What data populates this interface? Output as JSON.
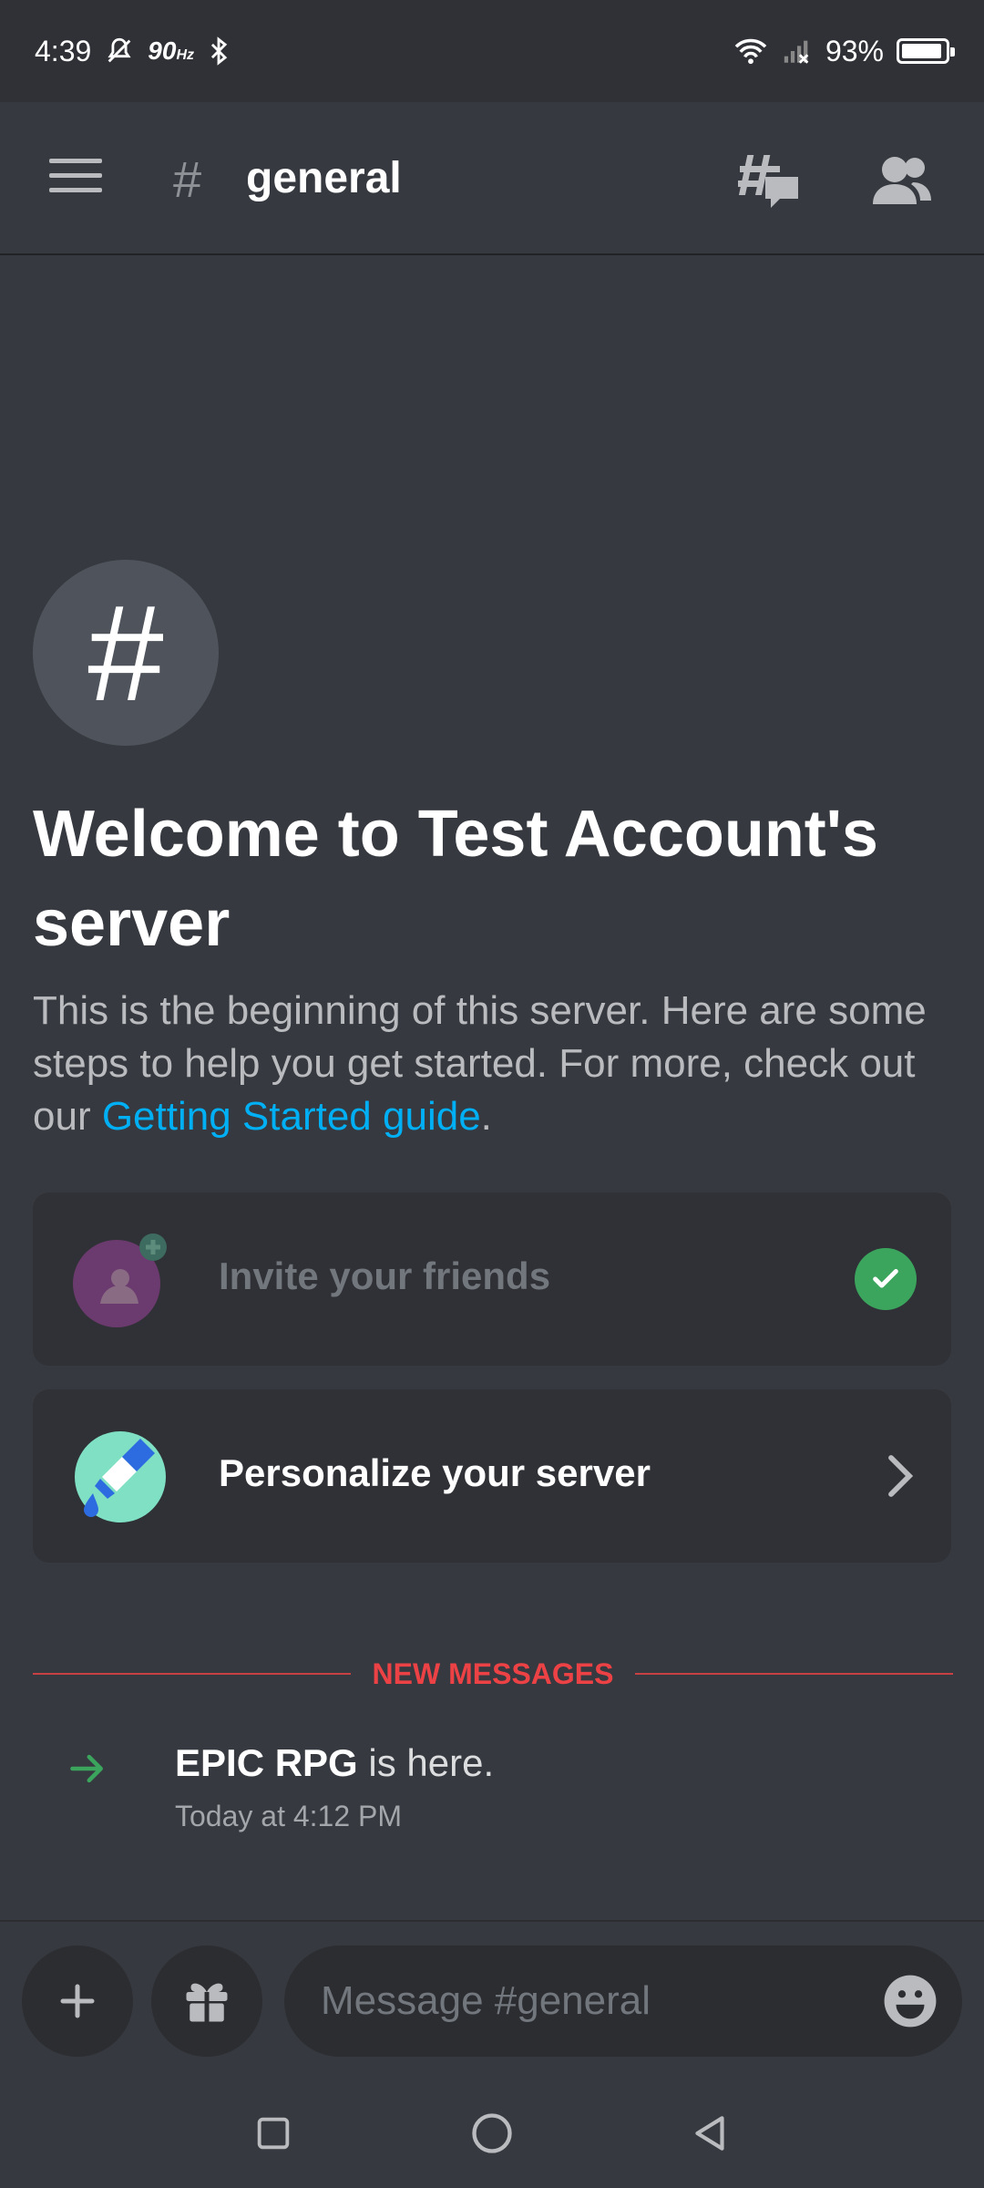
{
  "status_bar": {
    "time": "4:39",
    "refresh_rate": "90",
    "refresh_unit": "Hz",
    "battery": "93%",
    "battery_level": 0.93
  },
  "header": {
    "channel_name": "general",
    "icons": [
      "menu-icon",
      "hash-icon",
      "threads-icon",
      "members-icon"
    ]
  },
  "welcome": {
    "title": "Welcome to Test Account's server",
    "description": "This is the beginning of this server. Here are some steps to help you get started. For more, check out our ",
    "link_text": "Getting Started guide",
    "trailing": "."
  },
  "cards": [
    {
      "label": "Invite your friends",
      "completed": true
    },
    {
      "label": "Personalize your server",
      "completed": false
    }
  ],
  "divider": {
    "label": "NEW MESSAGES",
    "color": "#ed4245"
  },
  "system_message": {
    "bot_name": "EPIC RPG",
    "text": " is here.",
    "timestamp": "Today at 4:12 PM"
  },
  "composer": {
    "placeholder": "Message #general"
  },
  "colors": {
    "background": "#36393f",
    "card": "#2f3136",
    "link": "#00aff4",
    "success": "#3ba55d"
  }
}
